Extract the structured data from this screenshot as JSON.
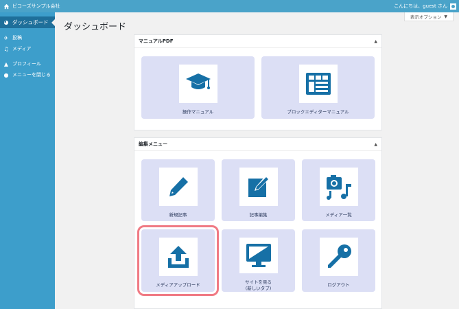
{
  "adminbar": {
    "site_name": "ビコーズサンプル会社",
    "greeting": "こんにちは、guest さん"
  },
  "screen_options": {
    "label": "表示オプション"
  },
  "sidebar": {
    "items": [
      {
        "label": "ダッシュボード",
        "icon": "dashboard-icon"
      },
      {
        "label": "投稿",
        "icon": "pin-icon"
      },
      {
        "label": "メディア",
        "icon": "media-icon"
      },
      {
        "label": "プロフィール",
        "icon": "user-icon"
      },
      {
        "label": "メニューを閉じる",
        "icon": "collapse-icon"
      }
    ]
  },
  "page": {
    "title": "ダッシュボード"
  },
  "manual_panel": {
    "title": "マニュアルPDF",
    "cards": [
      {
        "label": "操作マニュアル",
        "icon": "graduation-cap-icon"
      },
      {
        "label": "ブロックエディターマニュアル",
        "icon": "block-layout-icon"
      }
    ]
  },
  "edit_panel": {
    "title": "編集メニュー",
    "cards": [
      {
        "label": "新規記事",
        "icon": "pencil-icon"
      },
      {
        "label": "記事編集",
        "icon": "edit-icon"
      },
      {
        "label": "メディア一覧",
        "icon": "camera-music-icon"
      },
      {
        "label": "メディアアップロード",
        "icon": "upload-icon"
      },
      {
        "label": "サイトを見る",
        "label2": "(新しいタブ)",
        "icon": "monitor-icon"
      },
      {
        "label": "ログアウト",
        "icon": "key-icon"
      }
    ]
  },
  "colors": {
    "adminbar": "#4aa3c9",
    "sidebar": "#3d9ecb",
    "sidebar_active": "#1e6f9a",
    "card_bg": "#dcdff5",
    "icon_blue": "#1670a6",
    "highlight": "#f07a84"
  }
}
